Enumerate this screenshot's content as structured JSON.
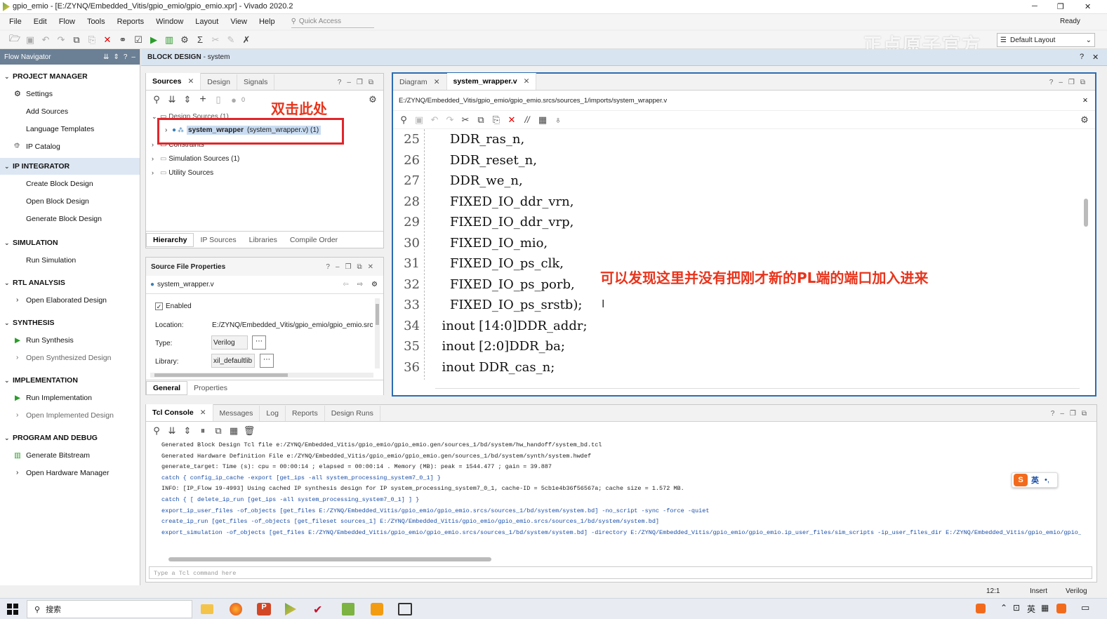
{
  "window": {
    "title": "gpio_emio - [E:/ZYNQ/Embedded_Vitis/gpio_emio/gpio_emio.xpr] - Vivado 2020.2",
    "status": "Ready",
    "min": "─",
    "max": "❐",
    "close": "✕"
  },
  "menu": [
    "File",
    "Edit",
    "Flow",
    "Tools",
    "Reports",
    "Window",
    "Layout",
    "View",
    "Help"
  ],
  "quick_access": {
    "placeholder": "Quick Access"
  },
  "layout_select": {
    "value": "Default Layout"
  },
  "watermark": "正点原子官方",
  "flow_nav": {
    "title": "Flow Navigator",
    "sections": [
      {
        "label": "PROJECT MANAGER",
        "items": [
          {
            "label": "Settings",
            "icon": "gear-icon"
          },
          {
            "label": "Add Sources"
          },
          {
            "label": "Language Templates"
          },
          {
            "label": "IP Catalog",
            "icon": "ip-icon"
          }
        ]
      },
      {
        "label": "IP INTEGRATOR",
        "items": [
          {
            "label": "Create Block Design"
          },
          {
            "label": "Open Block Design"
          },
          {
            "label": "Generate Block Design"
          }
        ]
      },
      {
        "label": "SIMULATION",
        "items": [
          {
            "label": "Run Simulation"
          }
        ]
      },
      {
        "label": "RTL ANALYSIS",
        "items": [
          {
            "label": "Open Elaborated Design"
          }
        ]
      },
      {
        "label": "SYNTHESIS",
        "items": [
          {
            "label": "Run Synthesis"
          },
          {
            "label": "Open Synthesized Design"
          }
        ]
      },
      {
        "label": "IMPLEMENTATION",
        "items": [
          {
            "label": "Run Implementation"
          },
          {
            "label": "Open Implemented Design"
          }
        ]
      },
      {
        "label": "PROGRAM AND DEBUG",
        "items": [
          {
            "label": "Generate Bitstream"
          },
          {
            "label": "Open Hardware Manager"
          }
        ]
      }
    ]
  },
  "block_design": {
    "label": "BLOCK DESIGN",
    "name": "- system"
  },
  "sources": {
    "tabs": [
      "Sources",
      "Design",
      "Signals"
    ],
    "badge": "0",
    "tree": {
      "design_sources": "Design Sources (1)",
      "top": "system_wrapper",
      "top_file": "(system_wrapper.v) (1)",
      "constraints": "Constraints",
      "sim": "Simulation Sources (1)",
      "util": "Utility Sources"
    },
    "bottom_tabs": [
      "Hierarchy",
      "IP Sources",
      "Libraries",
      "Compile Order"
    ],
    "annotation": "双击此处"
  },
  "sfp": {
    "title": "Source File Properties",
    "file": "system_wrapper.v",
    "enabled": "Enabled",
    "location_label": "Location:",
    "location": "E:/ZYNQ/Embedded_Vitis/gpio_emio/gpio_emio.src",
    "type_label": "Type:",
    "type": "Verilog",
    "library_label": "Library:",
    "library": "xil_defaultlib",
    "tabs": [
      "General",
      "Properties"
    ]
  },
  "editor": {
    "tabs": [
      "Diagram",
      "system_wrapper.v"
    ],
    "path": "E:/ZYNQ/Embedded_Vitis/gpio_emio/gpio_emio.srcs/sources_1/imports/system_wrapper.v",
    "lines": [
      {
        "n": "25",
        "t": "    DDR_ras_n,"
      },
      {
        "n": "26",
        "t": "    DDR_reset_n,"
      },
      {
        "n": "27",
        "t": "    DDR_we_n,"
      },
      {
        "n": "28",
        "t": "    FIXED_IO_ddr_vrn,"
      },
      {
        "n": "29",
        "t": "    FIXED_IO_ddr_vrp,"
      },
      {
        "n": "30",
        "t": "    FIXED_IO_mio,"
      },
      {
        "n": "31",
        "t": "    FIXED_IO_ps_clk,"
      },
      {
        "n": "32",
        "t": "    FIXED_IO_ps_porb,"
      },
      {
        "n": "33",
        "t": "    FIXED_IO_ps_srstb);"
      },
      {
        "n": "34",
        "t": "  inout [14:0]DDR_addr;"
      },
      {
        "n": "35",
        "t": "  inout [2:0]DDR_ba;"
      },
      {
        "n": "36",
        "t": "  inout DDR_cas_n;"
      }
    ],
    "annotation": "可以发现这里并没有把刚才新的PL端的端口加入进来"
  },
  "tcl": {
    "tabs": [
      "Tcl Console",
      "Messages",
      "Log",
      "Reports",
      "Design Runs"
    ],
    "lines": [
      {
        "t": "Generated Block Design Tcl file e:/ZYNQ/Embedded_Vitis/gpio_emio/gpio_emio.gen/sources_1/bd/system/hw_handoff/system_bd.tcl",
        "c": "k"
      },
      {
        "t": "Generated Hardware Definition File e:/ZYNQ/Embedded_Vitis/gpio_emio/gpio_emio.gen/sources_1/bd/system/synth/system.hwdef",
        "c": "k"
      },
      {
        "t": "generate_target: Time (s): cpu = 00:00:14 ; elapsed = 00:00:14 . Memory (MB): peak = 1544.477 ; gain = 39.887",
        "c": "k"
      },
      {
        "t": "catch { config_ip_cache -export [get_ips -all system_processing_system7_0_1] }",
        "c": "b"
      },
      {
        "t": "INFO: [IP_Flow 19-4993] Using cached IP synthesis design for IP system_processing_system7_0_1, cache-ID = 5cb1e4b36f56567a; cache size = 1.572 MB.",
        "c": "k"
      },
      {
        "t": "catch { [ delete_ip_run [get_ips -all system_processing_system7_0_1] ] }",
        "c": "b"
      },
      {
        "t": "export_ip_user_files -of_objects [get_files E:/ZYNQ/Embedded_Vitis/gpio_emio/gpio_emio.srcs/sources_1/bd/system/system.bd] -no_script -sync -force -quiet",
        "c": "b"
      },
      {
        "t": "create_ip_run [get_files -of_objects [get_fileset sources_1] E:/ZYNQ/Embedded_Vitis/gpio_emio/gpio_emio.srcs/sources_1/bd/system/system.bd]",
        "c": "b"
      },
      {
        "t": "export_simulation -of_objects [get_files E:/ZYNQ/Embedded_Vitis/gpio_emio/gpio_emio.srcs/sources_1/bd/system/system.bd] -directory E:/ZYNQ/Embedded_Vitis/gpio_emio/gpio_emio.ip_user_files/sim_scripts -ip_user_files_dir E:/ZYNQ/Embedded_Vitis/gpio_emio/gpio_emio.ip_us",
        "c": "b"
      }
    ],
    "input_placeholder": "Type a Tcl command here",
    "ime": "英"
  },
  "status": {
    "pos": "12:1",
    "mode": "Insert",
    "lang": "Verilog"
  },
  "taskbar": {
    "search": "搜索"
  },
  "colors": {
    "accent": "#2b6cb3",
    "annotation": "#e8341c",
    "flow_header": "#6b7f95",
    "bd_header": "#d9e4f1"
  }
}
